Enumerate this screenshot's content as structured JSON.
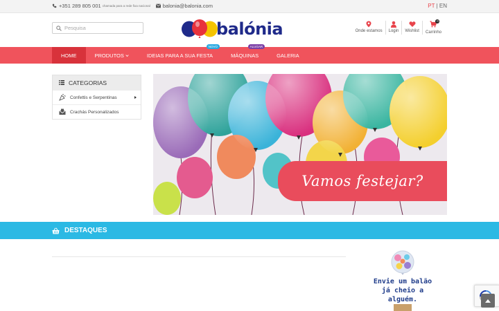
{
  "topbar": {
    "phone": "+351 289 805 001",
    "phone_note": "chamada para a rede fixa nacional",
    "email": "balonia@balonia.com",
    "lang_pt": "PT",
    "lang_sep": "|",
    "lang_en": "EN",
    "active_lang_color": "#e8444c"
  },
  "header": {
    "search_placeholder": "Pesquisa",
    "brand": "balónia",
    "links": {
      "location": "Onde estamos",
      "login": "Login",
      "wishlist": "Wishlist",
      "cart": "Carrinho",
      "cart_count": "0"
    }
  },
  "nav": {
    "items": [
      {
        "label": "Home",
        "active": true
      },
      {
        "label": "Produtos",
        "dropdown": true
      },
      {
        "label": "Ideias para a sua festa",
        "badge": "Novo"
      },
      {
        "label": "Máquinas",
        "badge": "Alugar"
      },
      {
        "label": "Galeria"
      }
    ],
    "bar_color": "#f0535c",
    "active_color": "#d8323b"
  },
  "categories": {
    "title": "Categorias",
    "items": [
      {
        "label": "Confettis e Serpentinas",
        "icon": "confetti-icon",
        "has_submenu": true
      },
      {
        "label": "Crachás Personalizados",
        "icon": "badge-envelope-icon",
        "has_submenu": false
      }
    ]
  },
  "hero": {
    "caption": "Vamos festejar?",
    "caption_bg": "#e94c5c"
  },
  "destaques": {
    "title": "Destaques",
    "bar_color": "#2bb9e4"
  },
  "promo": {
    "line1": "Envie um balão",
    "line2": "já cheio a",
    "line3": "alguém."
  }
}
